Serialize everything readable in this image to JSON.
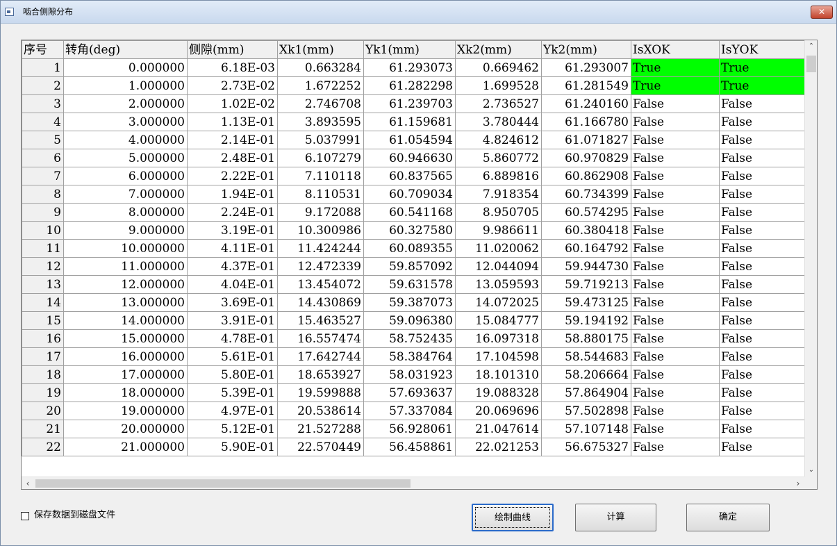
{
  "window": {
    "title": "啮合侧隙分布",
    "close_label": "✕"
  },
  "grid": {
    "columns": [
      "序号",
      "转角(deg)",
      "侧隙(mm)",
      "Xk1(mm)",
      "Yk1(mm)",
      "Xk2(mm)",
      "Yk2(mm)",
      "IsXOK",
      "IsYOK"
    ],
    "rows": [
      [
        "1",
        "0.000000",
        "6.18E-03",
        "0.663284",
        "61.293073",
        "0.669462",
        "61.293007",
        "True",
        "True"
      ],
      [
        "2",
        "1.000000",
        "2.73E-02",
        "1.672252",
        "61.282298",
        "1.699528",
        "61.281549",
        "True",
        "True"
      ],
      [
        "3",
        "2.000000",
        "1.02E-02",
        "2.746708",
        "61.239703",
        "2.736527",
        "61.240160",
        "False",
        "False"
      ],
      [
        "4",
        "3.000000",
        "1.13E-01",
        "3.893595",
        "61.159681",
        "3.780444",
        "61.166780",
        "False",
        "False"
      ],
      [
        "5",
        "4.000000",
        "2.14E-01",
        "5.037991",
        "61.054594",
        "4.824612",
        "61.071827",
        "False",
        "False"
      ],
      [
        "6",
        "5.000000",
        "2.48E-01",
        "6.107279",
        "60.946630",
        "5.860772",
        "60.970829",
        "False",
        "False"
      ],
      [
        "7",
        "6.000000",
        "2.22E-01",
        "7.110118",
        "60.837565",
        "6.889816",
        "60.862908",
        "False",
        "False"
      ],
      [
        "8",
        "7.000000",
        "1.94E-01",
        "8.110531",
        "60.709034",
        "7.918354",
        "60.734399",
        "False",
        "False"
      ],
      [
        "9",
        "8.000000",
        "2.24E-01",
        "9.172088",
        "60.541168",
        "8.950705",
        "60.574295",
        "False",
        "False"
      ],
      [
        "10",
        "9.000000",
        "3.19E-01",
        "10.300986",
        "60.327580",
        "9.986611",
        "60.380418",
        "False",
        "False"
      ],
      [
        "11",
        "10.000000",
        "4.11E-01",
        "11.424244",
        "60.089355",
        "11.020062",
        "60.164792",
        "False",
        "False"
      ],
      [
        "12",
        "11.000000",
        "4.37E-01",
        "12.472339",
        "59.857092",
        "12.044094",
        "59.944730",
        "False",
        "False"
      ],
      [
        "13",
        "12.000000",
        "4.04E-01",
        "13.454072",
        "59.631578",
        "13.059593",
        "59.719213",
        "False",
        "False"
      ],
      [
        "14",
        "13.000000",
        "3.69E-01",
        "14.430869",
        "59.387073",
        "14.072025",
        "59.473125",
        "False",
        "False"
      ],
      [
        "15",
        "14.000000",
        "3.91E-01",
        "15.463527",
        "59.096380",
        "15.084777",
        "59.194192",
        "False",
        "False"
      ],
      [
        "16",
        "15.000000",
        "4.78E-01",
        "16.557474",
        "58.752435",
        "16.097318",
        "58.880175",
        "False",
        "False"
      ],
      [
        "17",
        "16.000000",
        "5.61E-01",
        "17.642744",
        "58.384764",
        "17.104598",
        "58.544683",
        "False",
        "False"
      ],
      [
        "18",
        "17.000000",
        "5.80E-01",
        "18.653927",
        "58.031923",
        "18.101310",
        "58.206664",
        "False",
        "False"
      ],
      [
        "19",
        "18.000000",
        "5.39E-01",
        "19.599888",
        "57.693637",
        "19.088328",
        "57.864904",
        "False",
        "False"
      ],
      [
        "20",
        "19.000000",
        "4.97E-01",
        "20.538614",
        "57.337084",
        "20.069696",
        "57.502898",
        "False",
        "False"
      ],
      [
        "21",
        "20.000000",
        "5.12E-01",
        "21.527288",
        "56.928061",
        "21.047614",
        "57.107148",
        "False",
        "False"
      ],
      [
        "22",
        "21.000000",
        "5.90E-01",
        "22.570449",
        "56.458861",
        "22.021253",
        "56.675327",
        "False",
        "False"
      ]
    ],
    "ok_color": "#00ff00"
  },
  "scrollbars": {
    "up": "⌃",
    "down": "⌄",
    "left": "‹",
    "right": "›"
  },
  "options": {
    "save_to_disk_label": "保存数据到磁盘文件",
    "save_to_disk_checked": false
  },
  "buttons": {
    "plot_label": "绘制曲线",
    "calc_label": "计算",
    "ok_label": "确定"
  }
}
